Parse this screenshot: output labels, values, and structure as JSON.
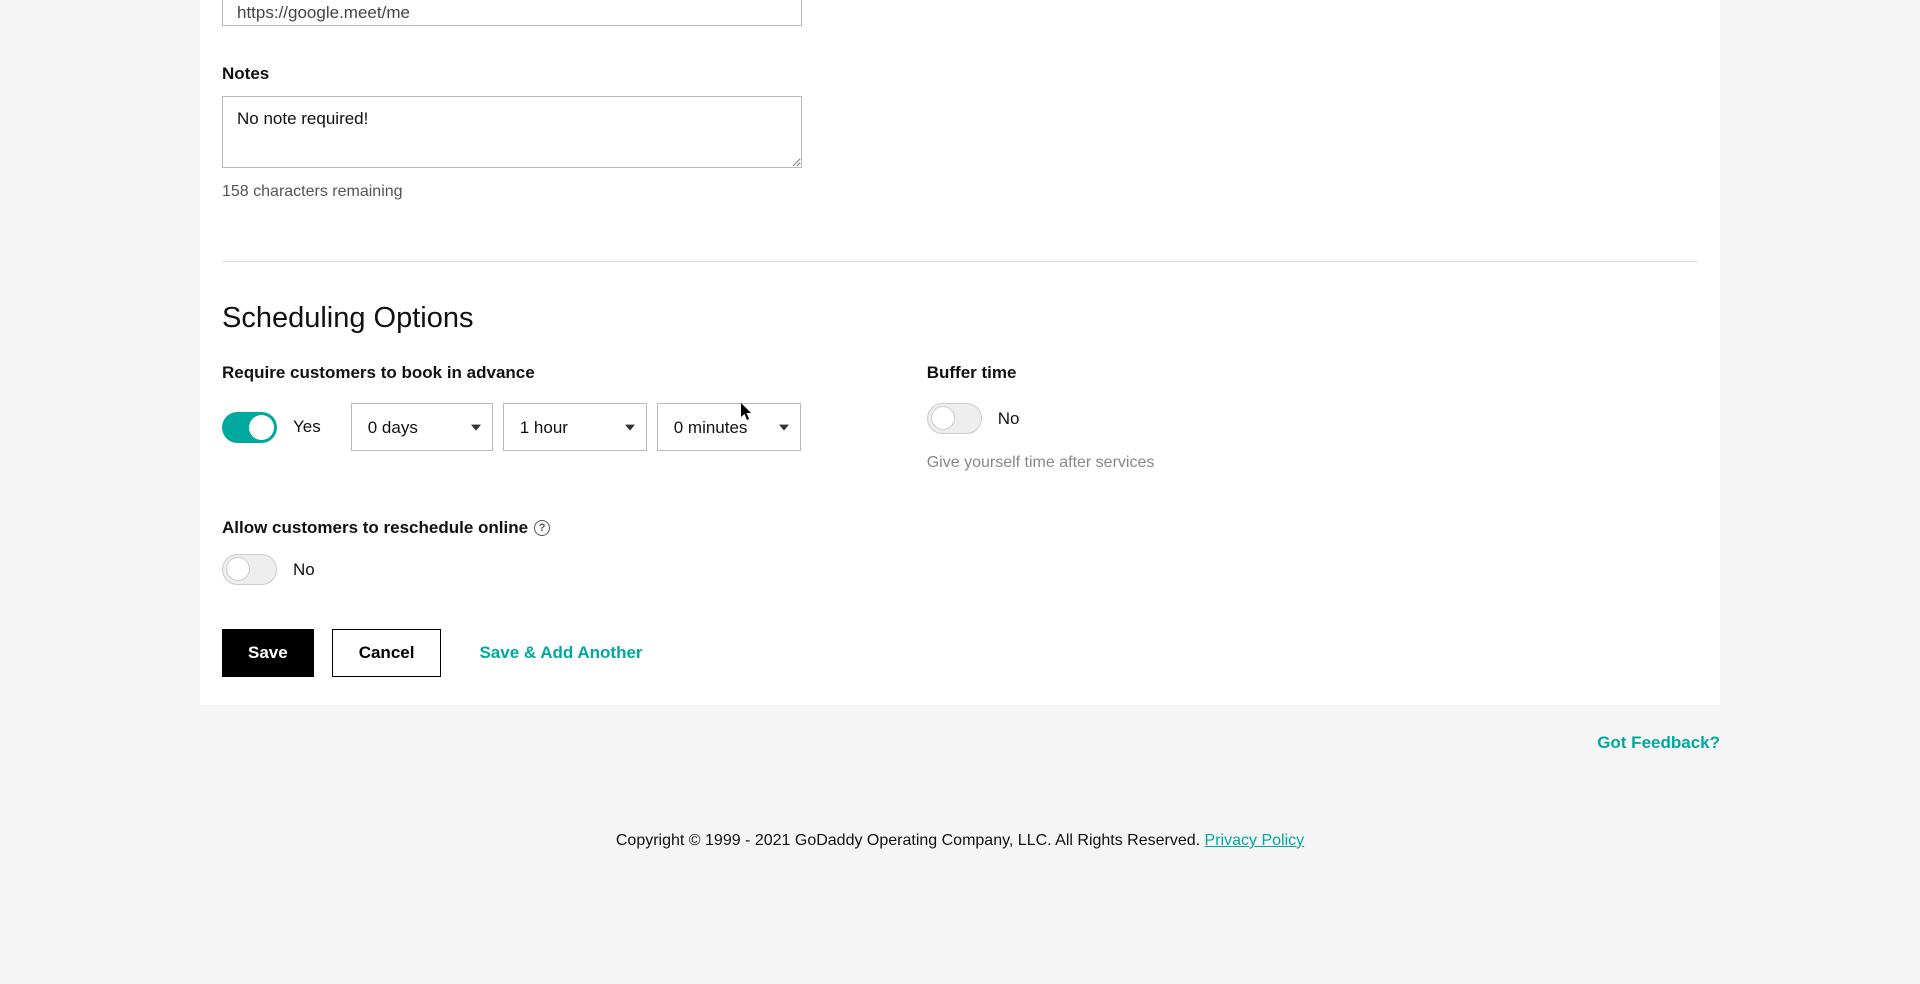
{
  "url_field": {
    "value": "https://google.meet/me"
  },
  "notes": {
    "label": "Notes",
    "value": "No note required!",
    "remaining": "158 characters remaining"
  },
  "scheduling": {
    "heading": "Scheduling Options",
    "advance": {
      "label": "Require customers to book in advance",
      "toggle_state": "Yes",
      "days": "0 days",
      "hours": "1 hour",
      "minutes": "0 minutes"
    },
    "buffer": {
      "label": "Buffer time",
      "toggle_state": "No",
      "helper": "Give yourself time after services"
    },
    "reschedule": {
      "label": "Allow customers to reschedule online",
      "toggle_state": "No"
    }
  },
  "buttons": {
    "save": "Save",
    "cancel": "Cancel",
    "save_add": "Save & Add Another"
  },
  "feedback": "Got Feedback?",
  "footer": {
    "copyright": "Copyright © 1999 - 2021 GoDaddy Operating Company, LLC. All Rights Reserved. ",
    "privacy": "Privacy Policy"
  }
}
